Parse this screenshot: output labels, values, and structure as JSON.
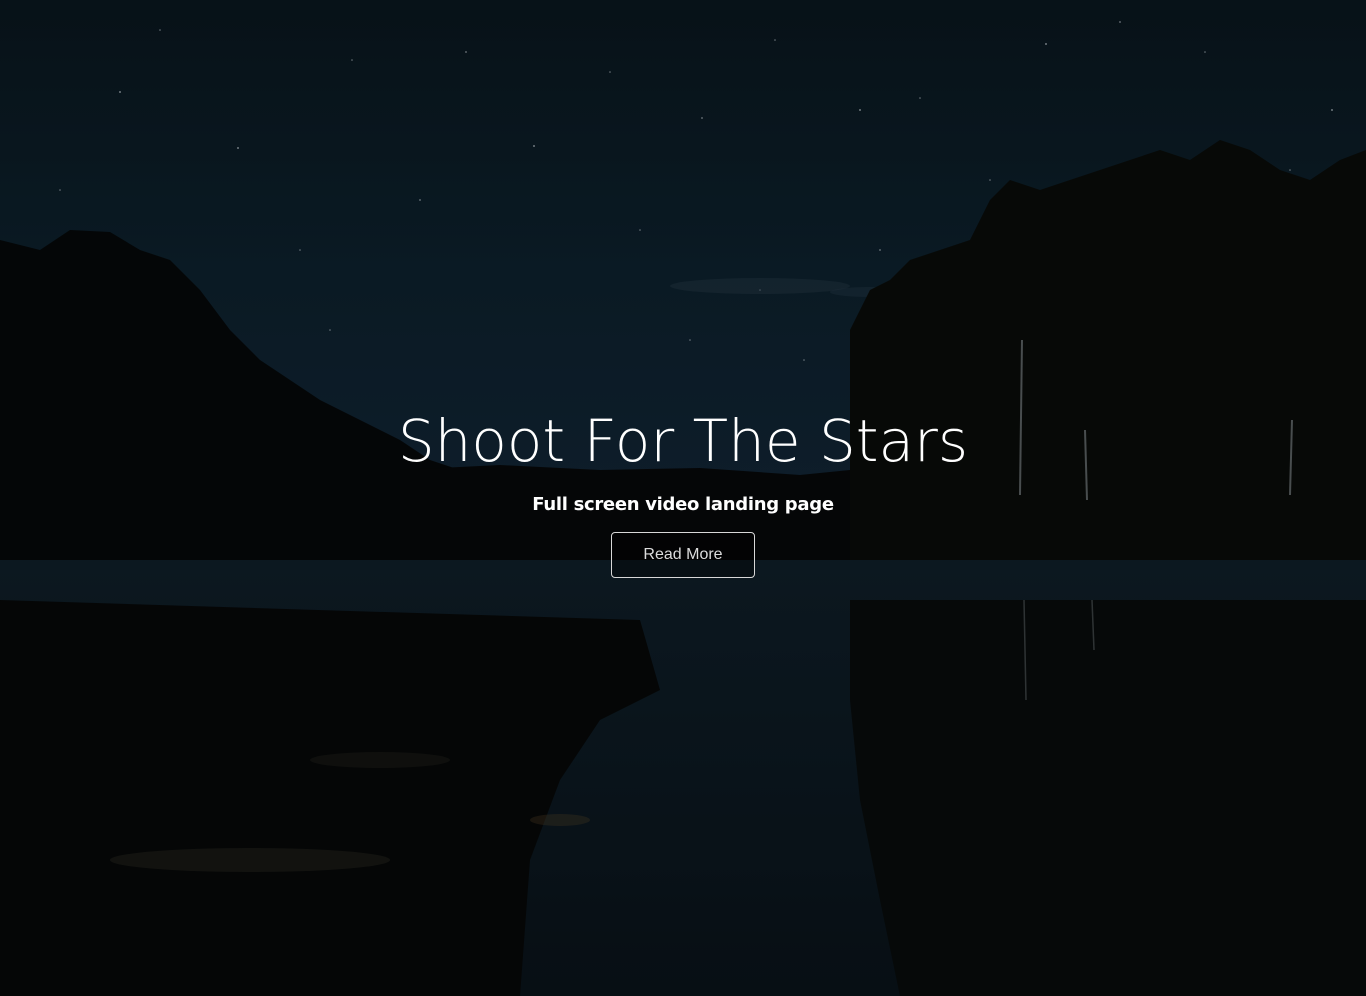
{
  "hero": {
    "title": "Shoot For The Stars",
    "subtitle": "Full screen video landing page",
    "button_label": "Read More"
  },
  "colors": {
    "sky_top": "#0a1a22",
    "water": "#0b1820",
    "text": "#ffffff",
    "button_border": "#d8d8d8"
  }
}
